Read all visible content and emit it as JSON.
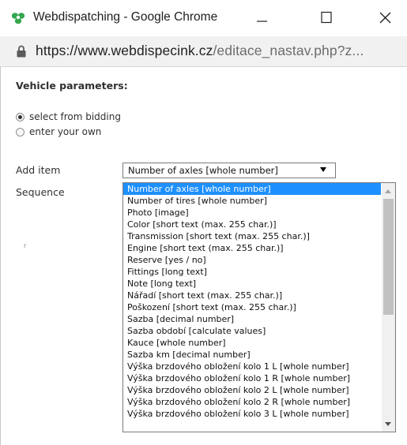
{
  "window": {
    "title": "Webdispatching - Google Chrome",
    "url_host": "https://www.webdispecink.cz",
    "url_path": "/editace_nastav.php?z..."
  },
  "section": {
    "title": "Vehicle parameters:"
  },
  "radios": [
    {
      "label": "select from bidding",
      "checked": true
    },
    {
      "label": "enter your own",
      "checked": false
    }
  ],
  "fields": {
    "add_item_label": "Add item",
    "sequence_label": "Sequence",
    "side_mark": "r"
  },
  "select": {
    "value": "Number of axles [whole number]"
  },
  "options": [
    "Number of axles [whole number]",
    "Number of tires [whole number]",
    "Photo [image]",
    "Color [short text (max. 255 char.)]",
    "Transmission [short text (max. 255 char.)]",
    "Engine [short text (max. 255 char.)]",
    "Reserve [yes / no]",
    "Fittings [long text]",
    "Note [long text]",
    "Nářadí [short text (max. 255 char.)]",
    "Poškození [short text (max. 255 char.)]",
    "Sazba [decimal number]",
    "Sazba období [calculate values]",
    "Kauce [whole number]",
    "Sazba km [decimal number]",
    "Výška brzdového obložení kolo 1 L [whole number]",
    "Výška brzdového obložení kolo 1 R [whole number]",
    "Výška brzdového obložení kolo 2 L [whole number]",
    "Výška brzdového obložení kolo 2 R [whole number]",
    "Výška brzdového obložení kolo 3 L [whole number]"
  ],
  "colors": {
    "selected_option_bg": "#1e90ff",
    "address_bar_bg": "#f1f1f1",
    "logo_green": "#35a64d"
  },
  "icons": {
    "app": "webdispatching-logo-icon",
    "minimize": "minimize-icon",
    "maximize": "maximize-icon",
    "close": "close-icon",
    "lock": "lock-icon",
    "dropdown": "chevron-down-icon"
  }
}
